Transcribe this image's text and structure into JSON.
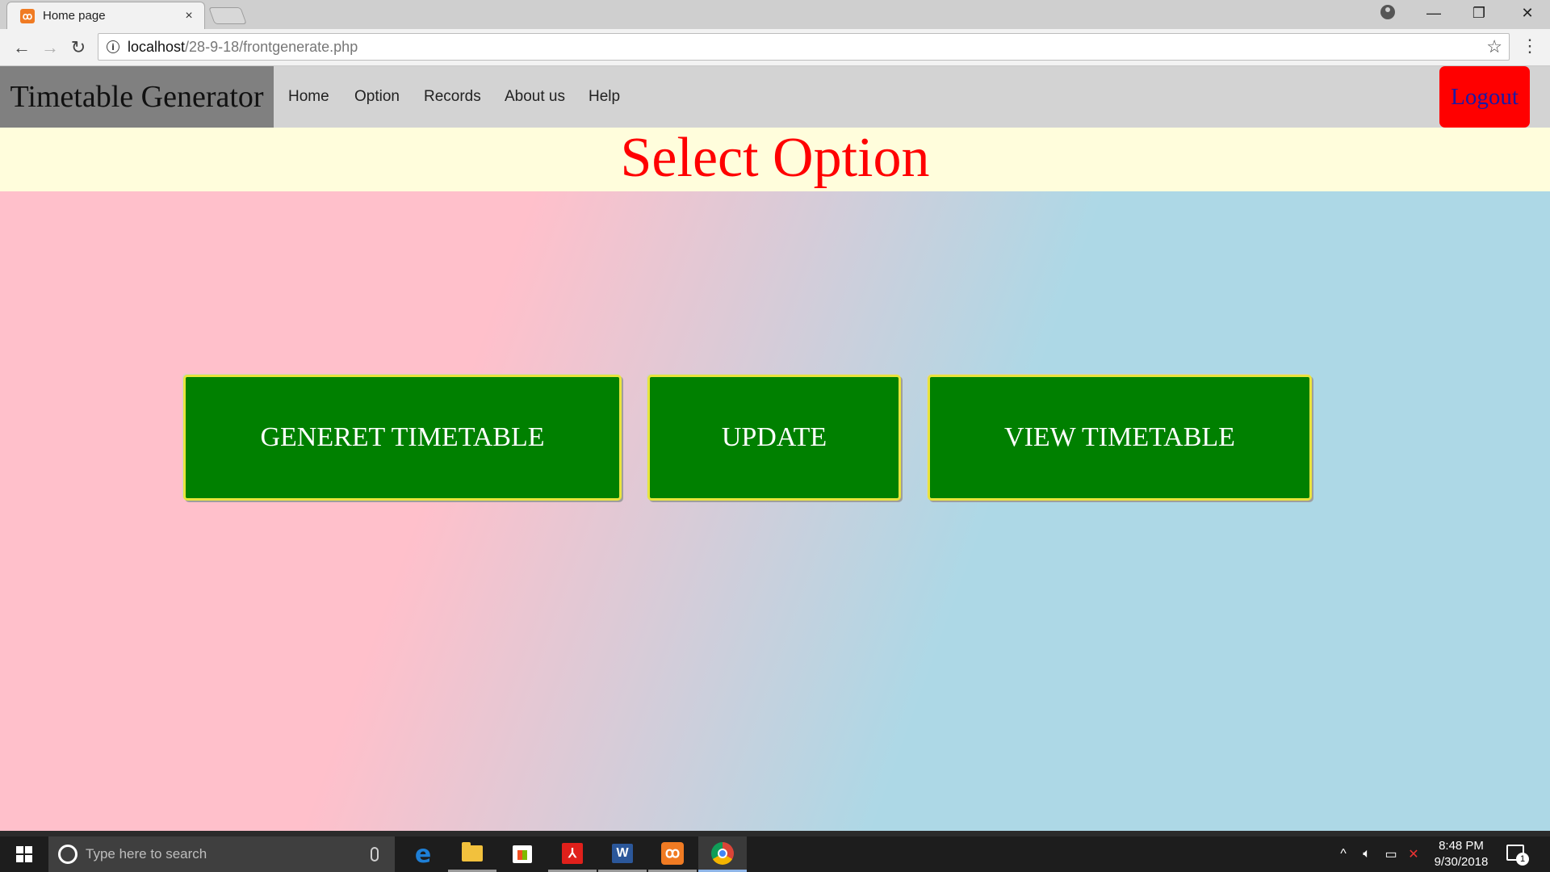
{
  "browser": {
    "tab_title": "Home page",
    "tab_close": "×",
    "url_host": "localhost",
    "url_path": "/28-9-18/frontgenerate.php"
  },
  "navbar": {
    "brand": "Timetable Generator",
    "links": [
      "Home",
      "Option",
      "Records",
      "About us",
      "Help"
    ],
    "logout": "Logout"
  },
  "header": {
    "title": "Select Option"
  },
  "options": {
    "generate": "GENERET TIMETABLE",
    "update": "UPDATE",
    "view": "VIEW TIMETABLE"
  },
  "taskbar": {
    "search_placeholder": "Type here to search",
    "time": "8:48 PM",
    "date": "9/30/2018",
    "notification_count": "1"
  },
  "colors": {
    "brand_bg": "#808080",
    "navbar_bg": "#d3d3d3",
    "logout_bg": "#ff0000",
    "header_bg": "#fffddc",
    "title_color": "#ff0000",
    "button_bg": "#008000",
    "gradient_start": "#ffc0cb",
    "gradient_end": "#add8e6"
  }
}
